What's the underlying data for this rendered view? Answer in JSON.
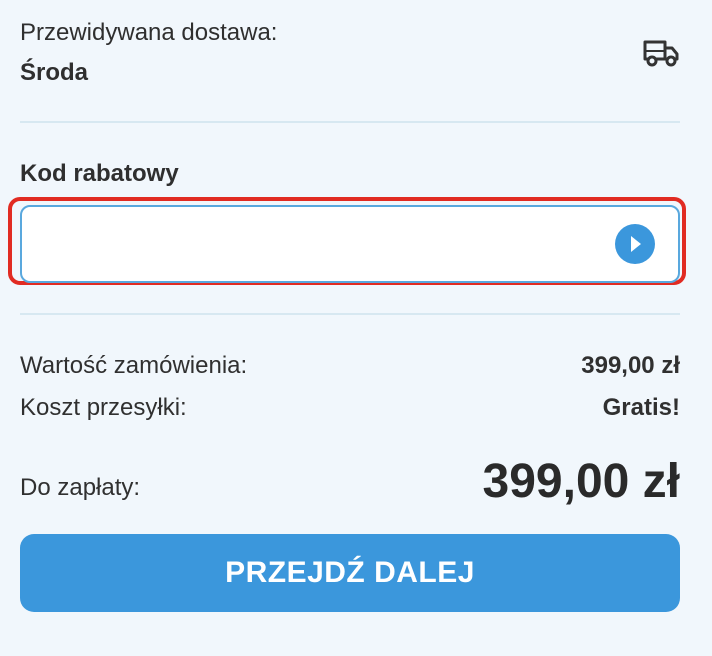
{
  "delivery": {
    "label": "Przewidywana dostawa:",
    "day": "Środa",
    "icon": "truck-icon"
  },
  "coupon": {
    "title": "Kod rabatowy",
    "value": "",
    "placeholder": "",
    "submit_icon": "play-circle-icon"
  },
  "summary": {
    "order_value_label": "Wartość zamówienia:",
    "order_value": "399,00 zł",
    "shipping_label": "Koszt przesyłki:",
    "shipping_value": "Gratis!",
    "total_label": "Do zapłaty:",
    "total_value": "399,00 zł"
  },
  "proceed_button": {
    "label": "PRZEJDŹ DALEJ"
  },
  "colors": {
    "background": "#f1f7fc",
    "accent": "#3b97dc",
    "highlight": "#e12b22",
    "divider": "#d7e8f1",
    "text": "#2b2b2b"
  }
}
